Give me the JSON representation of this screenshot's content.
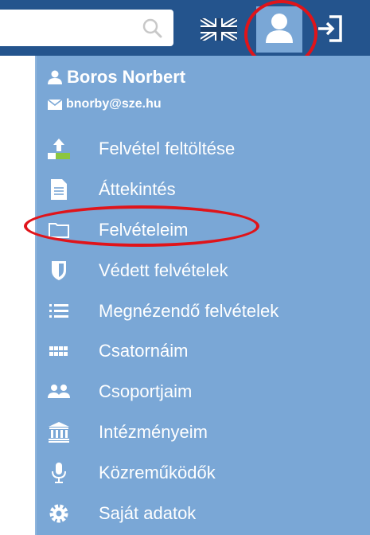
{
  "search": {
    "placeholder": ""
  },
  "header": {
    "language_icon": "uk-flag-icon",
    "user_icon": "user-icon",
    "exit_icon": "sign-out-icon"
  },
  "profile": {
    "name": "Boros Norbert",
    "email": "bnorby@sze.hu"
  },
  "menu": {
    "items": [
      {
        "label": "Felvétel feltöltése",
        "icon": "upload-icon"
      },
      {
        "label": "Áttekintés",
        "icon": "document-icon"
      },
      {
        "label": "Felvételeim",
        "icon": "folder-icon"
      },
      {
        "label": "Védett felvételek",
        "icon": "shield-icon"
      },
      {
        "label": "Megnézendő felvételek",
        "icon": "list-icon"
      },
      {
        "label": "Csatornáim",
        "icon": "channels-icon"
      },
      {
        "label": "Csoportjaim",
        "icon": "group-icon"
      },
      {
        "label": "Intézményeim",
        "icon": "institution-icon"
      },
      {
        "label": "Közreműködők",
        "icon": "microphone-icon"
      },
      {
        "label": "Saját adatok",
        "icon": "settings-icon"
      }
    ]
  },
  "colors": {
    "header_bg": "#24548d",
    "menu_bg": "#7aa7d6",
    "highlight_circle": "#e0141a"
  }
}
